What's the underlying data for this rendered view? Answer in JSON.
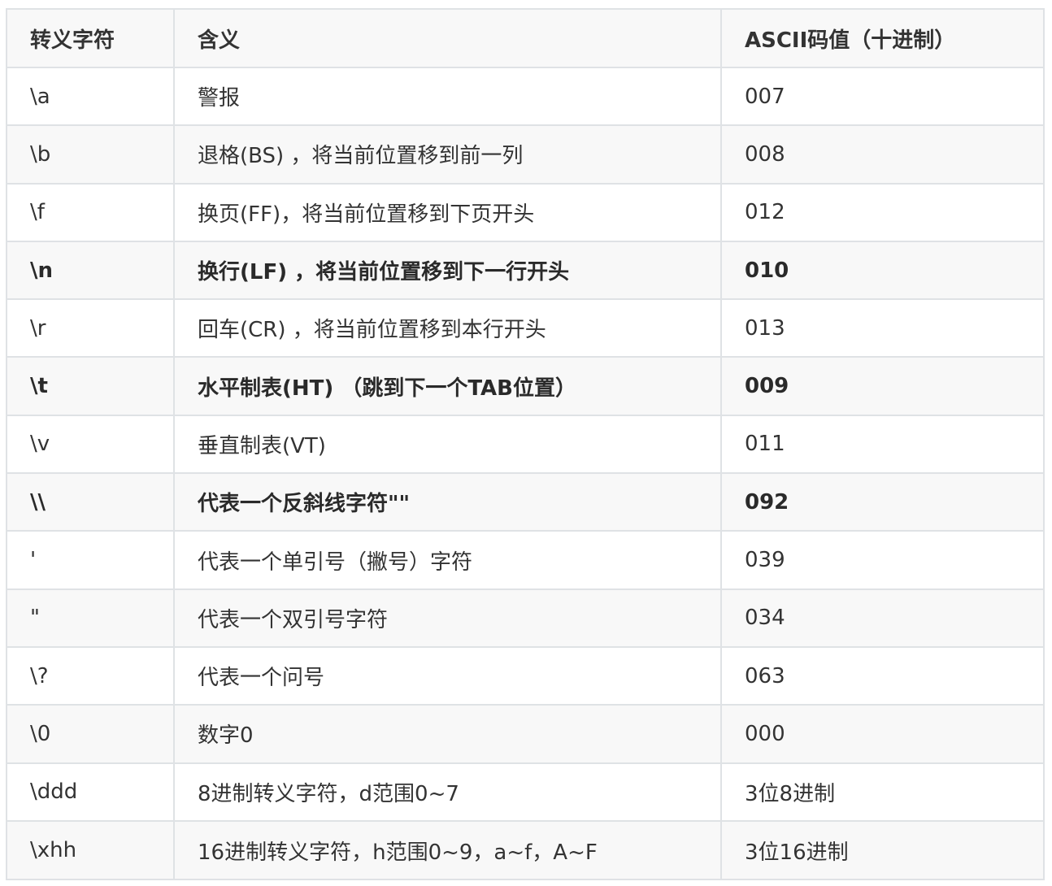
{
  "table": {
    "headers": [
      "转义字符",
      "含义",
      "ASCII码值（十进制）"
    ],
    "rows": [
      {
        "escape": "\\a",
        "meaning": "警报",
        "ascii": "007",
        "bold": false
      },
      {
        "escape": "\\b",
        "meaning": "退格(BS) ，将当前位置移到前一列",
        "ascii": "008",
        "bold": false
      },
      {
        "escape": "\\f",
        "meaning": "换页(FF)，将当前位置移到下页开头",
        "ascii": "012",
        "bold": false
      },
      {
        "escape": "\\n",
        "meaning": "换行(LF) ，将当前位置移到下一行开头",
        "ascii": "010",
        "bold": true
      },
      {
        "escape": "\\r",
        "meaning": "回车(CR) ，将当前位置移到本行开头",
        "ascii": "013",
        "bold": false
      },
      {
        "escape": "\\t",
        "meaning": "水平制表(HT) （跳到下一个TAB位置）",
        "ascii": "009",
        "bold": true
      },
      {
        "escape": "\\v",
        "meaning": "垂直制表(VT)",
        "ascii": "011",
        "bold": false
      },
      {
        "escape": "\\\\",
        "meaning": "代表一个反斜线字符\"\"",
        "ascii": "092",
        "bold": true
      },
      {
        "escape": "'",
        "meaning": "代表一个单引号（撇号）字符",
        "ascii": "039",
        "bold": false
      },
      {
        "escape": "\"",
        "meaning": "代表一个双引号字符",
        "ascii": "034",
        "bold": false
      },
      {
        "escape": "\\?",
        "meaning": "代表一个问号",
        "ascii": "063",
        "bold": false
      },
      {
        "escape": "\\0",
        "meaning": "数字0",
        "ascii": "000",
        "bold": false
      },
      {
        "escape": "\\ddd",
        "meaning": "8进制转义字符，d范围0~7",
        "ascii": "3位8进制",
        "bold": false
      },
      {
        "escape": "\\xhh",
        "meaning": "16进制转义字符，h范围0~9，a~f，A~F",
        "ascii": "3位16进制",
        "bold": false
      }
    ]
  }
}
